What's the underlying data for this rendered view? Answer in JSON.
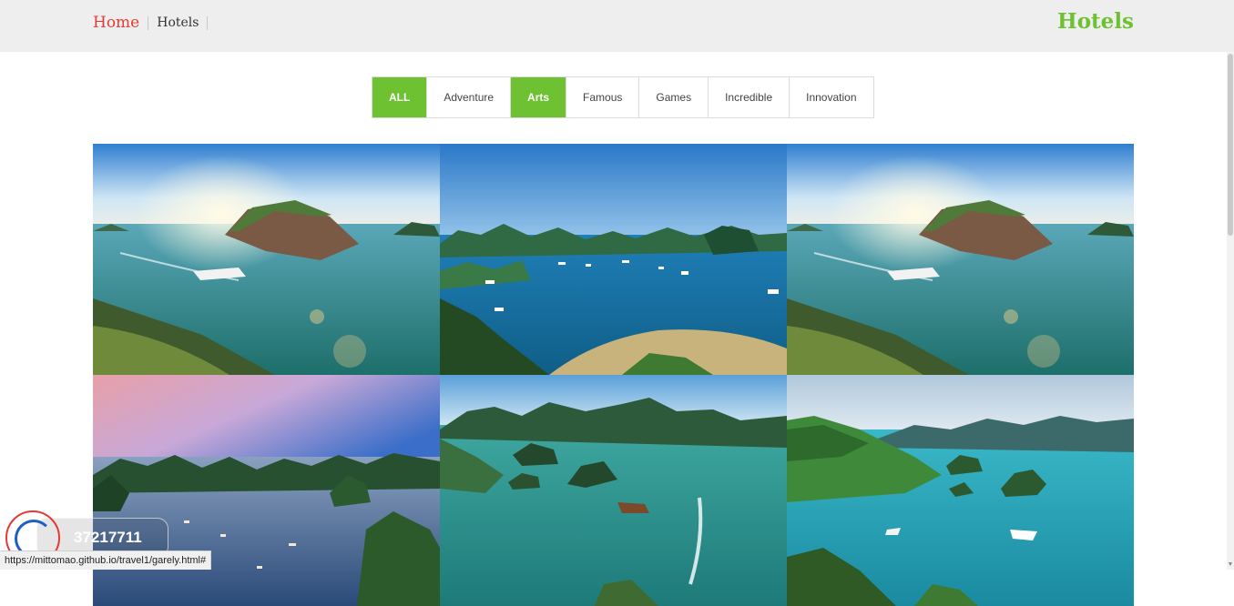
{
  "breadcrumb": {
    "home": "Home",
    "current": "Hotels"
  },
  "page_title": "Hotels",
  "filters": [
    {
      "label": "ALL",
      "active": true
    },
    {
      "label": "Adventure",
      "active": false
    },
    {
      "label": "Arts",
      "active": true
    },
    {
      "label": "Famous",
      "active": false
    },
    {
      "label": "Games",
      "active": false
    },
    {
      "label": "Incredible",
      "active": false
    },
    {
      "label": "Innovation",
      "active": false
    }
  ],
  "gallery": {
    "items": [
      {
        "scene": "seaplane-bay"
      },
      {
        "scene": "boats-bay"
      },
      {
        "scene": "seaplane-bay"
      },
      {
        "scene": "sunset-bay"
      },
      {
        "scene": "islands-bay"
      },
      {
        "scene": "turquoise-bay"
      }
    ]
  },
  "phone_widget": {
    "number": "37217711",
    "icon": "phone-icon"
  },
  "status_bar": {
    "url": "https://mittomao.github.io/travel1/garely.html#"
  },
  "colors": {
    "accent": "#6ec130",
    "home_link": "#e53935",
    "topbar": "#eeeeee"
  }
}
